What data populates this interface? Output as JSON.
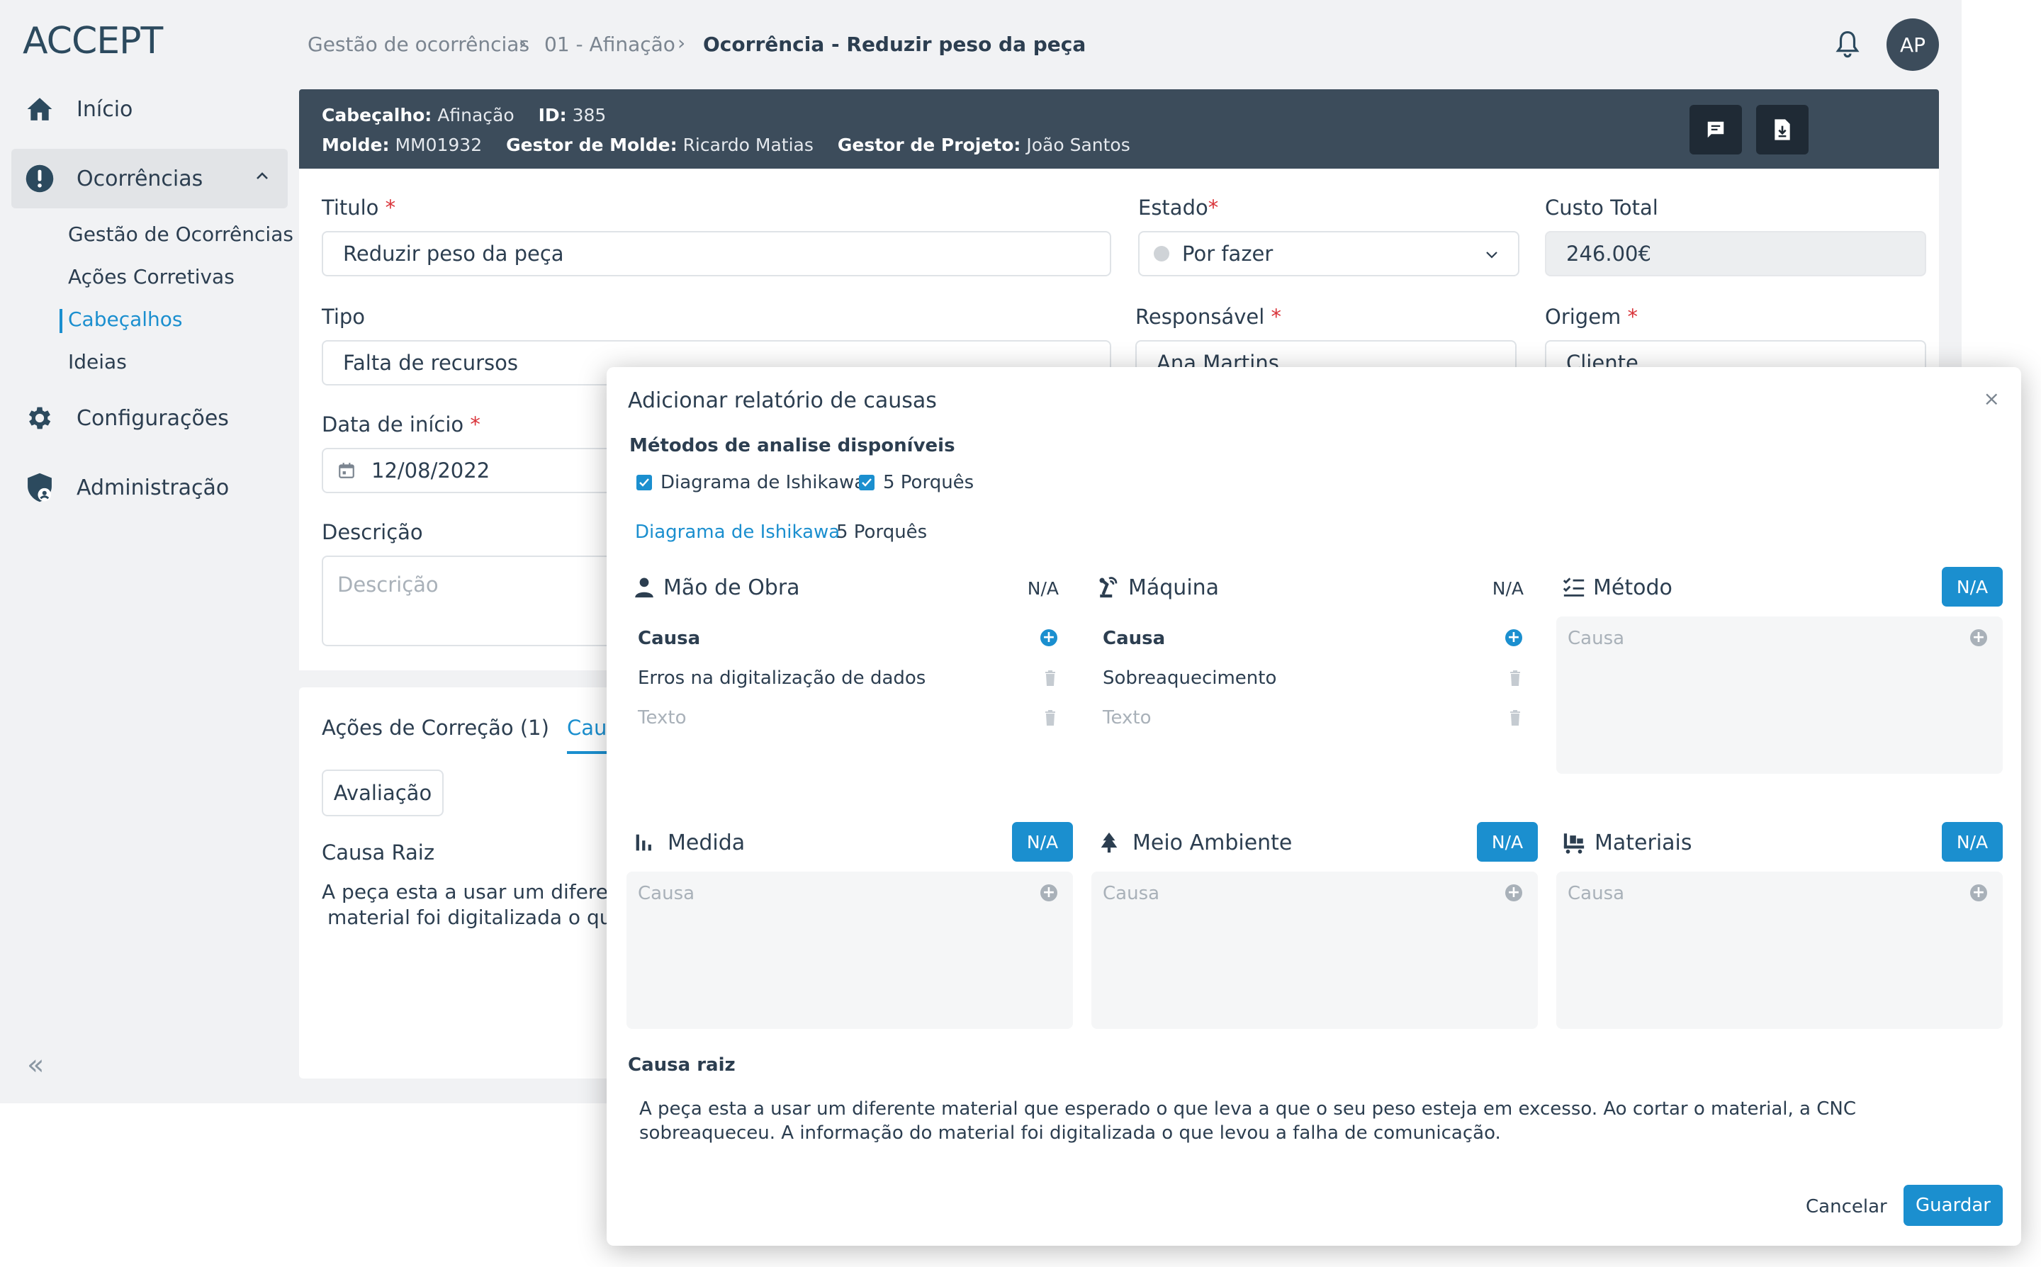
{
  "brand": {
    "logo_text": "ACCEPT",
    "accent": "#1b8fcf",
    "dark": "#3c4c5b"
  },
  "sidebar": {
    "items": [
      {
        "label": "Início",
        "icon": "home-icon"
      },
      {
        "label": "Ocorrências",
        "icon": "alert-circle-icon"
      },
      {
        "label": "Configurações",
        "icon": "gear-icon"
      },
      {
        "label": "Administração",
        "icon": "shield-user-icon"
      }
    ],
    "subitems": [
      "Gestão de Ocorrências",
      "Ações Corretivas",
      "Cabeçalhos",
      "Ideias"
    ],
    "collapse": "«"
  },
  "breadcrumb": {
    "items": [
      "Gestão de ocorrências",
      "01 - Afinação",
      "Ocorrência - Reduzir peso da peça"
    ]
  },
  "user": {
    "initials": "AP"
  },
  "header": {
    "cabecalho_label": "Cabeçalho:",
    "cabecalho": "Afinação",
    "id_label": "ID:",
    "id": "385",
    "molde_label": "Molde:",
    "molde": "MM01932",
    "gestor_molde_label": "Gestor de Molde:",
    "gestor_molde": "Ricardo Matias",
    "gestor_projeto_label": "Gestor de Projeto:",
    "gestor_projeto": "João Santos"
  },
  "form": {
    "titulo_label": "Titulo",
    "titulo": "Reduzir peso da peça",
    "estado_label": "Estado",
    "estado": "Por fazer",
    "custo_label": "Custo Total",
    "custo": "246.00€",
    "tipo_label": "Tipo",
    "tipo": "Falta de recursos",
    "responsavel_label": "Responsável",
    "responsavel": "Ana Martins",
    "origem_label": "Origem",
    "origem": "Cliente",
    "data_label": "Data de início",
    "data": "12/08/2022",
    "descricao_label": "Descrição",
    "descricao_placeholder": "Descrição",
    "required_mark": "*"
  },
  "lower": {
    "tab_acoes": "Ações de Correção (1)",
    "tab_causas": "Cau",
    "avaliacao": "Avaliação",
    "causa_raiz_label": "Causa Raiz",
    "causa_raiz_line1": "A peça esta a usar um diferent",
    "causa_raiz_line2": "material foi digitalizada o que"
  },
  "modal": {
    "title": "Adicionar relatório de causas",
    "close": "×",
    "methods_label": "Métodos de analise disponíveis",
    "method1": "Diagrama de Ishikawa",
    "method2": "5 Porquês",
    "tab1": "Diagrama de Ishikawa",
    "tab2": "5 Porquês",
    "na": "N/A",
    "cause_header": "Causa",
    "cause_placeholder": "Causa",
    "text_placeholder": "Texto",
    "categories": [
      {
        "name": "Mão de Obra",
        "icon": "person-icon",
        "cause": "Erros na digitalização de dados"
      },
      {
        "name": "Máquina",
        "icon": "machine-icon",
        "cause": "Sobreaquecimento"
      },
      {
        "name": "Método",
        "icon": "checklist-icon"
      },
      {
        "name": "Medida",
        "icon": "bar-chart-icon"
      },
      {
        "name": "Meio Ambiente",
        "icon": "tree-icon"
      },
      {
        "name": "Materiais",
        "icon": "trolley-icon"
      }
    ],
    "root_cause_label": "Causa raiz",
    "root_cause_text": "A peça esta a usar um diferente material que esperado o que leva a que o seu peso esteja em excesso. Ao cortar o material, a CNC sobreaqueceu. A informação do material foi digitalizada o que levou a falha de comunicação.",
    "cancel": "Cancelar",
    "save": "Guardar"
  }
}
